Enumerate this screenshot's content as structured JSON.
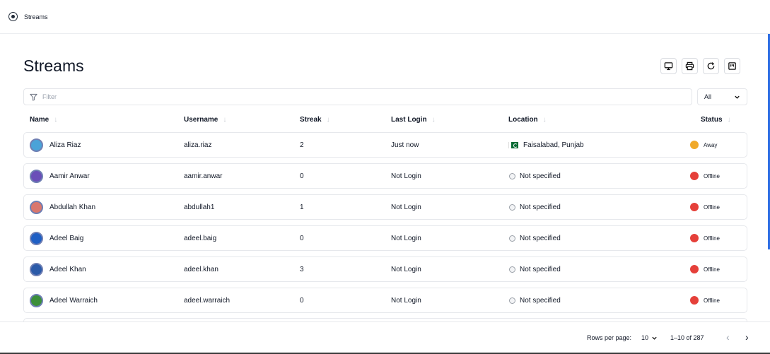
{
  "breadcrumb": {
    "label": "Streams"
  },
  "page": {
    "title": "Streams"
  },
  "filter": {
    "placeholder": "Filter"
  },
  "status_select": {
    "value": "All"
  },
  "columns": [
    "Name",
    "Username",
    "Streak",
    "Last Login",
    "Location",
    "Status"
  ],
  "rows": [
    {
      "name": "Aliza Riaz",
      "username": "aliza.riaz",
      "streak": "2",
      "last_login": "Just now",
      "location": "Faisalabad, Punjab",
      "status": "Away",
      "status_color": "#f0a92a",
      "avatar_color": "#4aa3d8",
      "has_flag": true
    },
    {
      "name": "Aamir Anwar",
      "username": "aamir.anwar",
      "streak": "0",
      "last_login": "Not Login",
      "location": "Not specified",
      "status": "Offline",
      "status_color": "#e5403a",
      "avatar_color": "#6a4fb8",
      "has_flag": false
    },
    {
      "name": "Abdullah Khan",
      "username": "abdullah1",
      "streak": "1",
      "last_login": "Not Login",
      "location": "Not specified",
      "status": "Offline",
      "status_color": "#e5403a",
      "avatar_color": "#d9776e",
      "has_flag": false
    },
    {
      "name": "Adeel Baig",
      "username": "adeel.baig",
      "streak": "0",
      "last_login": "Not Login",
      "location": "Not specified",
      "status": "Offline",
      "status_color": "#e5403a",
      "avatar_color": "#1f5fc4",
      "has_flag": false
    },
    {
      "name": "Adeel Khan",
      "username": "adeel.khan",
      "streak": "3",
      "last_login": "Not Login",
      "location": "Not specified",
      "status": "Offline",
      "status_color": "#e5403a",
      "avatar_color": "#2b5aa8",
      "has_flag": false
    },
    {
      "name": "Adeel Warraich",
      "username": "adeel.warraich",
      "streak": "0",
      "last_login": "Not Login",
      "location": "Not specified",
      "status": "Offline",
      "status_color": "#e5403a",
      "avatar_color": "#3c8f3a",
      "has_flag": false
    }
  ],
  "pagination": {
    "rows_per_page_label": "Rows per page:",
    "rows_per_page": "10",
    "range": "1–10 of 287"
  },
  "icons": [
    "radio-icon",
    "monitor-icon",
    "printer-icon",
    "refresh-icon",
    "columns-icon",
    "filter-icon",
    "chevron-down-icon",
    "sort-arrow-icon",
    "globe-icon",
    "flag-icon",
    "chevron-left-icon",
    "chevron-right-icon"
  ]
}
